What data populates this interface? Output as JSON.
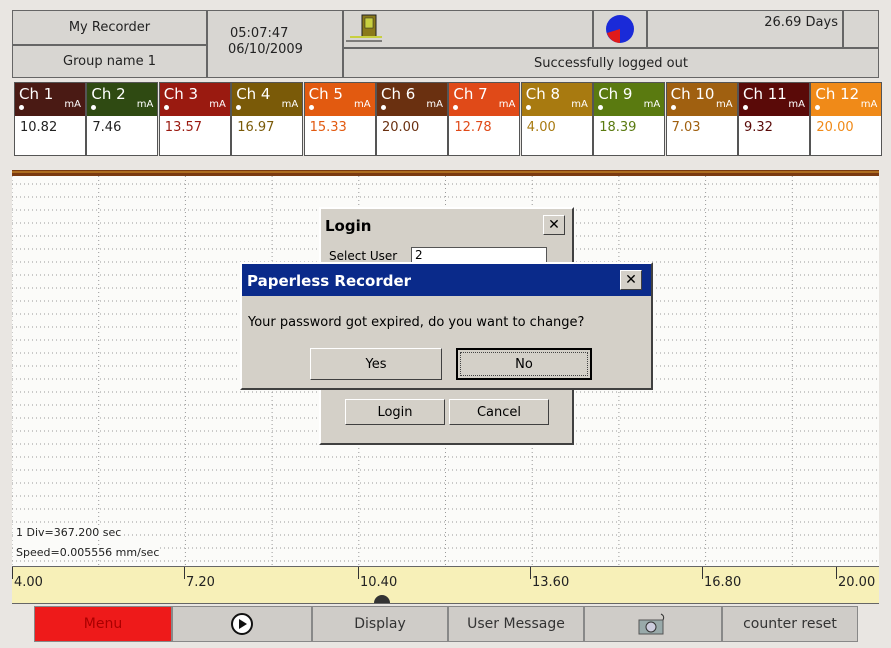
{
  "header": {
    "recorder_name": "My Recorder",
    "group_name": "Group name 1",
    "time": "05:07:47",
    "date": "06/10/2009",
    "days": "26.69 Days",
    "status": "Successfully logged out"
  },
  "channels": [
    {
      "name": "Ch 1",
      "unit": "mA",
      "value": "10.82",
      "color": "#4a1a14"
    },
    {
      "name": "Ch 2",
      "unit": "mA",
      "value": "7.46",
      "color": "#2f4a12"
    },
    {
      "name": "Ch 3",
      "unit": "mA",
      "value": "13.57",
      "color": "#9a1a10"
    },
    {
      "name": "Ch 4",
      "unit": "mA",
      "value": "16.97",
      "color": "#7a5a08"
    },
    {
      "name": "Ch 5",
      "unit": "mA",
      "value": "15.33",
      "color": "#e25a10"
    },
    {
      "name": "Ch 6",
      "unit": "mA",
      "value": "20.00",
      "color": "#6a3010"
    },
    {
      "name": "Ch 7",
      "unit": "mA",
      "value": "12.78",
      "color": "#e04a18"
    },
    {
      "name": "Ch 8",
      "unit": "mA",
      "value": "4.00",
      "color": "#a87a10"
    },
    {
      "name": "Ch 9",
      "unit": "mA",
      "value": "18.39",
      "color": "#5a7a10"
    },
    {
      "name": "Ch 10",
      "unit": "mA",
      "value": "7.03",
      "color": "#a06010"
    },
    {
      "name": "Ch 11",
      "unit": "mA",
      "value": "9.32",
      "color": "#5a0a08"
    },
    {
      "name": "Ch 12",
      "unit": "mA",
      "value": "20.00",
      "color": "#f08a18"
    }
  ],
  "chart": {
    "div_info": "1 Div=367.200 sec",
    "speed": "Speed=0.005556 mm/sec",
    "scale_labels": [
      "4.00",
      "7.20",
      "10.40",
      "13.60",
      "16.80",
      "20.00"
    ]
  },
  "login_dialog": {
    "title": "Login",
    "select_user_label": "Select User",
    "select_user_value": "2",
    "login_button": "Login",
    "cancel_button": "Cancel"
  },
  "alert_dialog": {
    "title": "Paperless Recorder",
    "message": "Your password got expired, do you want to change?",
    "yes_button": "Yes",
    "no_button": "No"
  },
  "bottom_bar": {
    "menu": "Menu",
    "display": "Display",
    "user_message": "User Message",
    "counter_reset": "counter reset"
  },
  "colors": {
    "menu_button": "#ee1a1a",
    "dialog_titlebar": "#0a2a8a",
    "scale_band": "#f7f0b8"
  }
}
